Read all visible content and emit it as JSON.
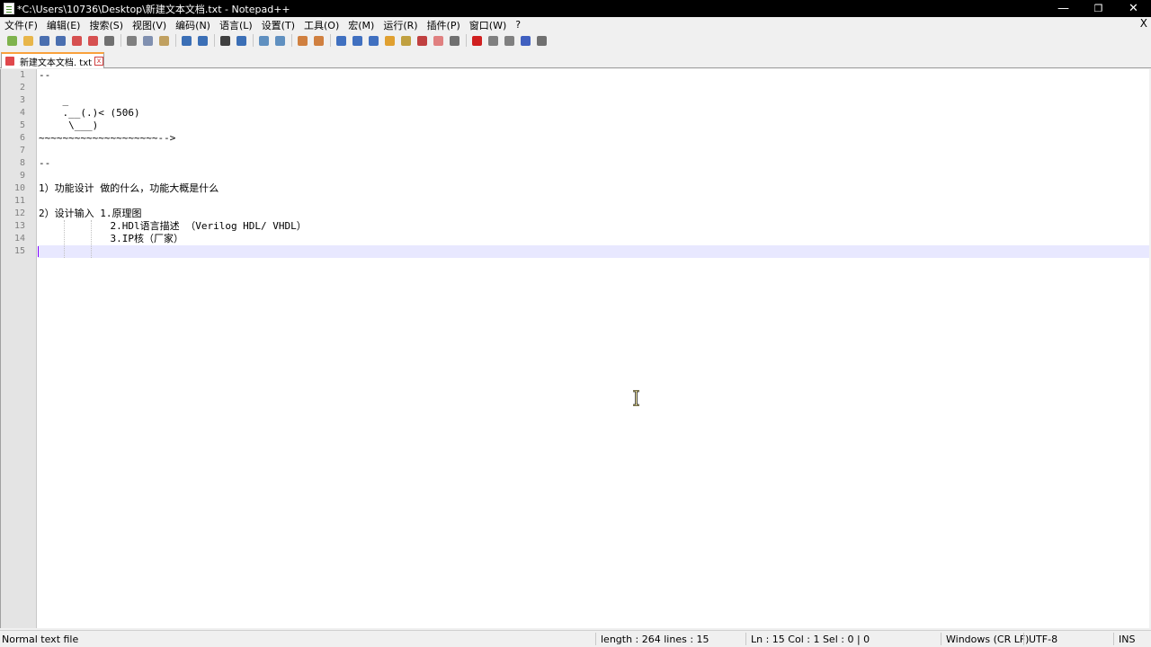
{
  "window": {
    "title": "*C:\\Users\\10736\\Desktop\\新建文本文档.txt - Notepad++",
    "minimize": "—",
    "restore": "❐",
    "close": "✕"
  },
  "menu": {
    "items": [
      "文件(F)",
      "编辑(E)",
      "搜索(S)",
      "视图(V)",
      "编码(N)",
      "语言(L)",
      "设置(T)",
      "工具(O)",
      "宏(M)",
      "运行(R)",
      "插件(P)",
      "窗口(W)",
      "?"
    ],
    "close": "X"
  },
  "toolbar": {
    "buttons": [
      {
        "name": "new-file-icon",
        "color": "#7fb34d"
      },
      {
        "name": "open-file-icon",
        "color": "#e8b64a"
      },
      {
        "name": "save-icon",
        "color": "#4a6fb0"
      },
      {
        "name": "save-all-icon",
        "color": "#4a6fb0"
      },
      {
        "name": "close-icon",
        "color": "#d65050"
      },
      {
        "name": "close-all-icon",
        "color": "#d65050"
      },
      {
        "name": "print-icon",
        "color": "#707070"
      },
      {
        "sep": true
      },
      {
        "name": "cut-icon",
        "color": "#808080"
      },
      {
        "name": "copy-icon",
        "color": "#8090b0"
      },
      {
        "name": "paste-icon",
        "color": "#c0a060"
      },
      {
        "sep": true
      },
      {
        "name": "undo-icon",
        "color": "#3b6fb6"
      },
      {
        "name": "redo-icon",
        "color": "#3b6fb6"
      },
      {
        "sep": true
      },
      {
        "name": "find-icon",
        "color": "#404040"
      },
      {
        "name": "replace-icon",
        "color": "#3b6fb6"
      },
      {
        "sep": true
      },
      {
        "name": "zoom-in-icon",
        "color": "#6090c0"
      },
      {
        "name": "zoom-out-icon",
        "color": "#6090c0"
      },
      {
        "sep": true
      },
      {
        "name": "sync-vertical-icon",
        "color": "#d08040"
      },
      {
        "name": "sync-horizontal-icon",
        "color": "#d08040"
      },
      {
        "sep": true
      },
      {
        "name": "word-wrap-icon",
        "color": "#4070c0"
      },
      {
        "name": "show-all-characters-icon",
        "color": "#4070c0"
      },
      {
        "name": "indent-guide-icon",
        "color": "#4070c0"
      },
      {
        "name": "user-defined-language-icon",
        "color": "#e0a030"
      },
      {
        "name": "document-map-icon",
        "color": "#c0a040"
      },
      {
        "name": "function-list-icon",
        "color": "#c04040"
      },
      {
        "name": "folder-as-workspace-icon",
        "color": "#e08080"
      },
      {
        "name": "monitoring-icon",
        "color": "#707070"
      },
      {
        "sep": true
      },
      {
        "name": "record-macro-icon",
        "color": "#d02020"
      },
      {
        "name": "stop-recording-icon",
        "color": "#808080"
      },
      {
        "name": "playback-macro-icon",
        "color": "#808080"
      },
      {
        "name": "run-macro-multiple-icon",
        "color": "#4060c0"
      },
      {
        "name": "save-macro-icon",
        "color": "#707070"
      }
    ]
  },
  "tab": {
    "label": "新建文本文档. txt",
    "close": "x"
  },
  "editor": {
    "lines": [
      "--",
      "",
      "    _",
      "    .__(.)< (506)",
      "     \\___)",
      "~~~~~~~~~~~~~~~~~~~~-->",
      "",
      "--",
      "",
      "1）功能设计 做的什么，功能大概是什么",
      "",
      "2）设计输入 1.原理图",
      "            2.HDl语言描述 （Verilog HDL/ VHDL）",
      "            3.IP核（厂家）",
      "",
      ""
    ],
    "line_numbers": [
      "1",
      "2",
      "3",
      "4",
      "5",
      "6",
      "7",
      "8",
      "9",
      "10",
      "11",
      "12",
      "13",
      "14",
      "15"
    ]
  },
  "status": {
    "file_type": "Normal text file",
    "length": "length : 264    lines : 15",
    "position": "Ln : 15    Col : 1    Sel : 0 | 0",
    "eol": "Windows (CR LF)",
    "encoding": "UTF-8",
    "mode": "INS"
  }
}
